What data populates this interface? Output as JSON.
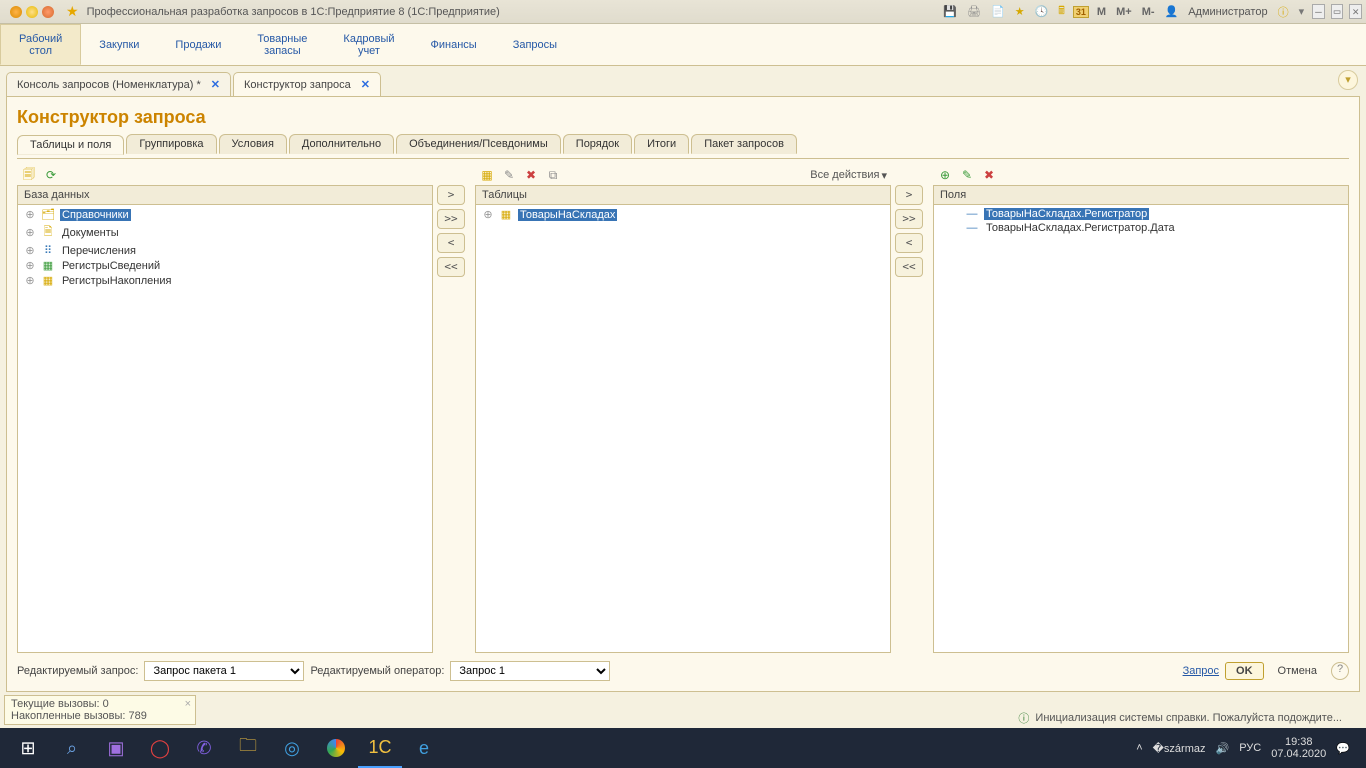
{
  "titlebar": {
    "app_title": "Профессиональная разработка запросов в 1С:Предприятие 8  (1С:Предприятие)",
    "calendar_day": "31",
    "m": "M",
    "m_plus": "M+",
    "m_minus": "M-",
    "user": "Администратор"
  },
  "mainnav": {
    "items": [
      {
        "label": "Рабочий\nстол"
      },
      {
        "label": "Закупки"
      },
      {
        "label": "Продажи"
      },
      {
        "label": "Товарные\nзапасы"
      },
      {
        "label": "Кадровый\nучет"
      },
      {
        "label": "Финансы"
      },
      {
        "label": "Запросы"
      }
    ]
  },
  "doctabs": {
    "items": [
      {
        "label": "Консоль запросов (Номенклатура) *"
      },
      {
        "label": "Конструктор запроса"
      }
    ]
  },
  "page_title": "Конструктор запроса",
  "inner_tabs": [
    "Таблицы и поля",
    "Группировка",
    "Условия",
    "Дополнительно",
    "Объединения/Псевдонимы",
    "Порядок",
    "Итоги",
    "Пакет запросов"
  ],
  "move_buttons": {
    "r": ">",
    "rr": ">>",
    "l": "<",
    "ll": "<<"
  },
  "panel_db": {
    "title": "База данных",
    "items": [
      "Справочники",
      "Документы",
      "Перечисления",
      "РегистрыСведений",
      "РегистрыНакопления"
    ]
  },
  "panel_tables": {
    "title": "Таблицы",
    "all_actions": "Все действия",
    "items": [
      "ТоварыНаСкладах"
    ]
  },
  "panel_fields": {
    "title": "Поля",
    "items": [
      "ТоварыНаСкладах.Регистратор",
      "ТоварыНаСкладах.Регистратор.Дата"
    ]
  },
  "bottom": {
    "label_query": "Редактируемый запрос:",
    "select_query": "Запрос пакета 1",
    "label_operator": "Редактируемый оператор:",
    "select_operator": "Запрос 1",
    "link_query": "Запрос",
    "ok": "OK",
    "cancel": "Отмена",
    "help": "?"
  },
  "miniwin": {
    "line1": "Текущие вызовы: 0",
    "line2": "Накопленные вызовы: 789"
  },
  "statusbar": "Инициализация системы справки. Пожалуйста подождите...",
  "tray": {
    "lang": "РУС",
    "time": "19:38",
    "date": "07.04.2020"
  }
}
